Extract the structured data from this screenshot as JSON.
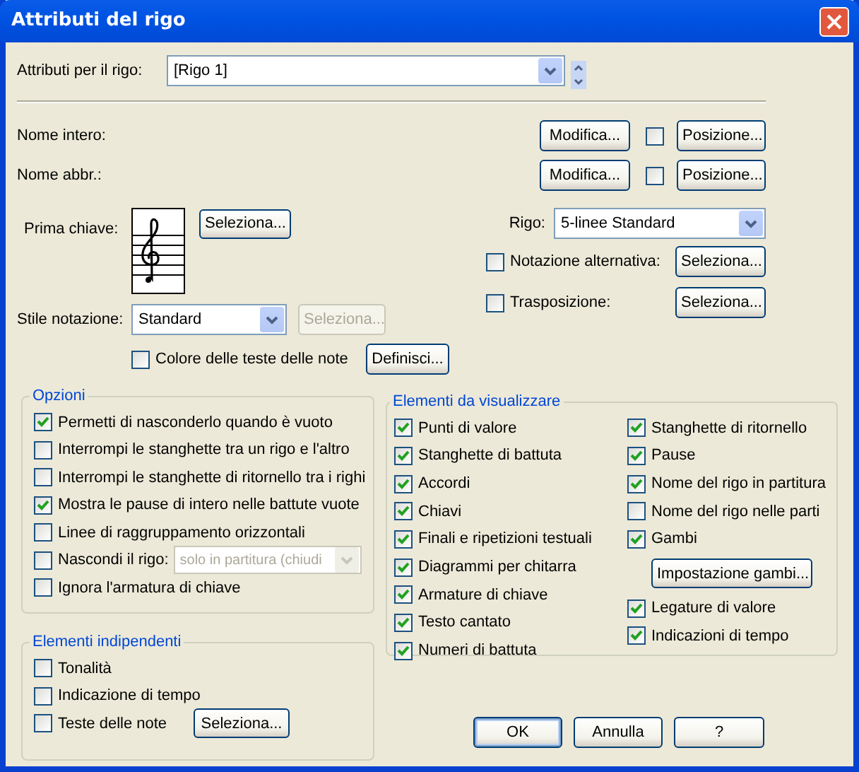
{
  "window": {
    "title": "Attributi del rigo"
  },
  "staff_selector": {
    "label": "Attributi per il rigo:",
    "value": "[Rigo 1]"
  },
  "name_rows": [
    {
      "label": "Nome intero:",
      "edit_button": "Modifica...",
      "checked": false,
      "position_button": "Posizione..."
    },
    {
      "label": "Nome abbr.:",
      "edit_button": "Modifica...",
      "checked": false,
      "position_button": "Posizione..."
    }
  ],
  "first_clef": {
    "label": "Prima chiave:",
    "button": "Seleziona..."
  },
  "notation_style": {
    "label": "Stile notazione:",
    "value": "Standard",
    "button": "Seleziona...",
    "button_disabled": true
  },
  "notehead_color": {
    "label": "Colore delle teste delle note",
    "checked": false,
    "button": "Definisci..."
  },
  "staff": {
    "label": "Rigo:",
    "value": "5-linee Standard"
  },
  "alternate_notation": {
    "label": "Notazione alternativa:",
    "checked": false,
    "button": "Seleziona..."
  },
  "transposition": {
    "label": "Trasposizione:",
    "checked": false,
    "button": "Seleziona..."
  },
  "options": {
    "title": "Opzioni",
    "items": [
      {
        "kind": "checkbox",
        "label": "Permetti di nasconderlo quando è vuoto",
        "checked": true
      },
      {
        "kind": "checkbox",
        "label": "Interrompi le stanghette tra un rigo e l'altro",
        "checked": false
      },
      {
        "kind": "checkbox",
        "label": "Interrompi le stanghette di ritornello tra i righi",
        "checked": false
      },
      {
        "kind": "checkbox",
        "label": "Mostra le pause di intero nelle battute vuote",
        "checked": true
      },
      {
        "kind": "checkbox",
        "label": "Linee di raggruppamento orizzontali",
        "checked": false
      },
      {
        "kind": "select",
        "label": "Nascondi il rigo:",
        "checked": false,
        "value": "solo in partitura (chiudi",
        "disabled": true
      },
      {
        "kind": "checkbox",
        "label": "Ignora l'armatura di chiave",
        "checked": false
      }
    ]
  },
  "independent": {
    "title": "Elementi indipendenti",
    "items": [
      {
        "kind": "checkbox",
        "label": "Tonalità",
        "checked": false
      },
      {
        "kind": "checkbox",
        "label": "Indicazione di tempo",
        "checked": false
      },
      {
        "kind": "button",
        "label": "Teste delle note",
        "checked": false,
        "button": "Seleziona..."
      }
    ]
  },
  "display_items": {
    "title": "Elementi da visualizzare",
    "columns": [
      [
        {
          "kind": "checkbox",
          "label": "Punti di valore",
          "checked": true
        },
        {
          "kind": "checkbox",
          "label": "Stanghette di battuta",
          "checked": true
        },
        {
          "kind": "checkbox",
          "label": "Accordi",
          "checked": true
        },
        {
          "kind": "checkbox",
          "label": "Chiavi",
          "checked": true
        },
        {
          "kind": "checkbox",
          "label": "Finali e ripetizioni testuali",
          "checked": true
        },
        {
          "kind": "checkbox",
          "label": "Diagrammi per chitarra",
          "checked": true
        },
        {
          "kind": "checkbox",
          "label": "Armature di chiave",
          "checked": true
        },
        {
          "kind": "checkbox",
          "label": "Testo cantato",
          "checked": true
        },
        {
          "kind": "checkbox",
          "label": "Numeri di battuta",
          "checked": true
        }
      ],
      [
        {
          "kind": "checkbox",
          "label": "Stanghette di ritornello",
          "checked": true
        },
        {
          "kind": "checkbox",
          "label": "Pause",
          "checked": true
        },
        {
          "kind": "checkbox",
          "label": "Nome del rigo in partitura",
          "checked": true
        },
        {
          "kind": "checkbox",
          "label": "Nome del rigo nelle parti",
          "checked": false
        },
        {
          "kind": "checkbox",
          "label": "Gambi",
          "checked": true
        },
        {
          "kind": "button",
          "label": "Impostazione gambi..."
        },
        {
          "kind": "checkbox",
          "label": "Legature di valore",
          "checked": true
        },
        {
          "kind": "checkbox",
          "label": "Indicazioni di tempo",
          "checked": true
        }
      ]
    ]
  },
  "buttons": [
    {
      "label": "OK",
      "default": true
    },
    {
      "label": "Annulla",
      "default": false
    },
    {
      "label": "?",
      "default": false
    }
  ]
}
